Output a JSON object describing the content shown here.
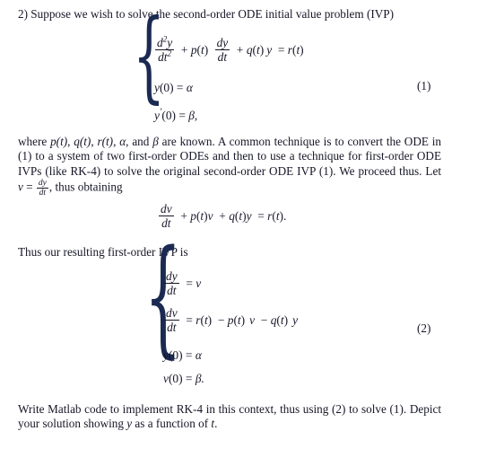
{
  "document": {
    "problem_number": "2)",
    "intro_text": "Suppose we wish to solve the second-order ODE initial value problem (IVP)",
    "equations": {
      "eq1": {
        "number": "(1)",
        "rows": [
          {
            "id": "ode2",
            "latex": "d^2y/dt^2 + p(t) dy/dt + q(t) y = r(t)",
            "numerator_1": "d",
            "numerator_1_exp": "2",
            "numerator_1_var": "y",
            "denominator_1": "dt",
            "denominator_1_exp": "2",
            "plus": "+",
            "p_of_t": "p(t)",
            "dy": "dy",
            "dt": "dt",
            "q_of_t": "q(t)",
            "y": "y",
            "equals": "=",
            "r_of_t": "r(t)"
          },
          {
            "id": "ic1",
            "latex": "y(0) = \\alpha",
            "text_y": "y",
            "paren0": "(0)",
            "equals": "=",
            "alpha": "α"
          },
          {
            "id": "ic2",
            "latex": "y'(0) = \\beta,",
            "text_y": "y",
            "prime": "′",
            "paren0": "(0)",
            "equals": "=",
            "beta": "β",
            "comma": ","
          }
        ]
      },
      "eq_dv": {
        "latex": "dv/dt + p(t)v + q(t)y = r(t).",
        "num": "dv",
        "den": "dt",
        "rest": "+ p(t)v + q(t)y = r(t)."
      },
      "eq2": {
        "number": "(2)",
        "rows": [
          {
            "id": "dydt",
            "latex": "dy/dt = v",
            "num": "dy",
            "den": "dt",
            "equals": "=",
            "rhs": "v"
          },
          {
            "id": "dvdt",
            "latex": "dv/dt = r(t) - p(t) v - q(t) y",
            "num": "dv",
            "den": "dt",
            "equals": "=",
            "rhs": "r(t) − p(t) v − q(t) y"
          },
          {
            "id": "ic1",
            "latex": "y(0) = \\alpha",
            "lhs": "y(0)",
            "equals": "=",
            "rhs": "α"
          },
          {
            "id": "ic2",
            "latex": "v(0) = \\beta.",
            "lhs": "v(0)",
            "equals": "=",
            "rhs": "β."
          }
        ]
      }
    },
    "paragraph_2": {
      "line_1_a": "where ",
      "line_1_b": "p(t)",
      "line_1_c": ", ",
      "line_1_d": "q(t)",
      "line_1_e": ", ",
      "line_1_f": "r(t)",
      "line_1_g": ", ",
      "line_1_h": "α",
      "line_1_i": ", and ",
      "line_1_j": "β",
      "line_1_k": " are known.  A common technique is to convert the ODE in (1) to a system of two first-order ODEs and then to use a technique for first-order ODE IVPs (like RK-4) to solve the original second-order ODE IVP (1).  We proceed thus.  Let ",
      "v_symbol": "v",
      "equals": "=",
      "frac_num": "dy",
      "frac_den": "dt",
      "tail": ", thus obtaining"
    },
    "paragraph_3": "Thus our resulting first-order IVP is",
    "paragraph_4": {
      "a": "Write Matlab code to implement RK-4 in this context, thus using (2) to solve (1).  Depict your solution showing ",
      "y": "y",
      "b": " as a function of ",
      "t": "t",
      "c": "."
    }
  }
}
